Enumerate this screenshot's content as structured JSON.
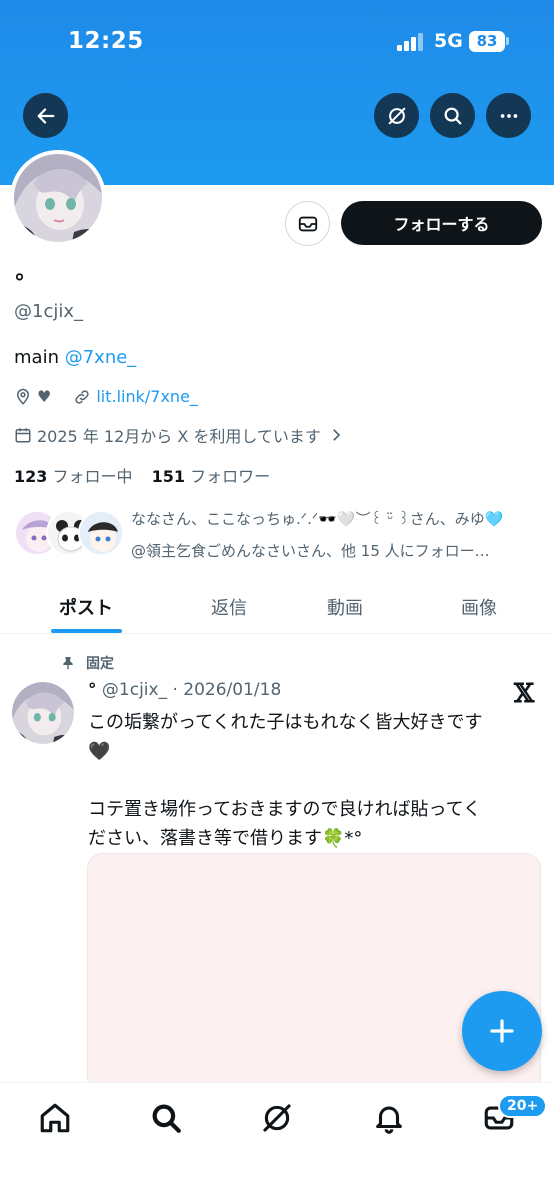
{
  "status_bar": {
    "time": "12:25",
    "network": "5G",
    "battery": "83"
  },
  "profile": {
    "display_name": "°",
    "handle": "@1cjix_",
    "bio_text": "main",
    "bio_mention": "@7xne_",
    "location_heart": "♥",
    "link": "lit.link/7xne_",
    "joined": "2025 年 12月から X を利用しています",
    "following_count": "123",
    "following_label": "フォロー中",
    "followers_count": "151",
    "followers_label": "フォロワー",
    "follow_button": "フォローする"
  },
  "followed_by": {
    "line1": "ななさん、ここなっちゅ.ᐟ.ᐟ🕶️🤍︶꒰ ᵕ̈ ꒱さん、みゆ🩵",
    "line2": "@領主乞食ごめんなさいさん、他 15 人にフォロー…"
  },
  "tabs": [
    {
      "label": "ポスト",
      "active": true
    },
    {
      "label": "返信",
      "active": false
    },
    {
      "label": "動画",
      "active": false
    },
    {
      "label": "画像",
      "active": false
    }
  ],
  "pinned_post": {
    "pinned_label": "固定",
    "author": "°",
    "handle": "@1cjix_",
    "separator": "·",
    "date": "2026/01/18",
    "source_logo": "𝕏",
    "text": "この垢繋がってくれた子はもれなく皆大好きです\n🖤\n\nコテ置き場作っておきますので良ければ貼ってく\nださい、落書き等で借ります🍀*°"
  },
  "bottom_nav": {
    "messages_badge": "20+"
  },
  "colors": {
    "accent": "#1d9bf0",
    "text": "#0f1419",
    "muted": "#536471",
    "banner": "#1f8ae8"
  },
  "icons": [
    "back-arrow-icon",
    "grok-icon",
    "search-icon",
    "more-icon",
    "message-icon",
    "location-icon",
    "heart-icon",
    "link-icon",
    "calendar-icon",
    "chevron-right-icon",
    "pin-icon",
    "x-logo-icon",
    "plus-icon",
    "home-icon",
    "bell-icon",
    "mail-icon"
  ]
}
